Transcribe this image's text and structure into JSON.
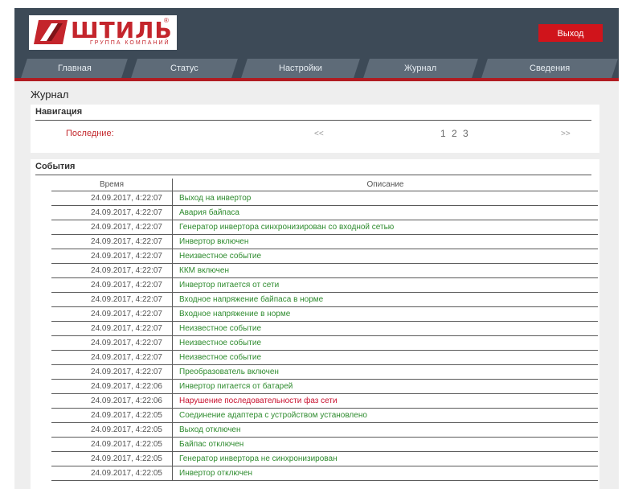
{
  "header": {
    "logo_text": "ШТИЛЬ",
    "logo_subtext": "ГРУППА КОМПАНИЙ",
    "logo_reg": "®",
    "logout_label": "Выход"
  },
  "colors": {
    "header_bg": "#3d4a57",
    "accent_red": "#d0141b",
    "success_green": "#2e8b2e",
    "error_red": "#c8102e"
  },
  "nav": {
    "tabs": [
      {
        "label": "Главная"
      },
      {
        "label": "Статус"
      },
      {
        "label": "Настройки"
      },
      {
        "label": "Журнал"
      },
      {
        "label": "Сведения"
      }
    ]
  },
  "page": {
    "title": "Журнал"
  },
  "navigation_panel": {
    "title": "Навигация",
    "last_label": "Последние:",
    "prev": "<<",
    "pages": "1 2 3",
    "next": ">>"
  },
  "events_panel": {
    "title": "События",
    "columns": [
      "Время",
      "Описание"
    ],
    "rows": [
      {
        "time": "24.09.2017, 4:22:07",
        "desc": "Выход на инвертор",
        "status": "ok"
      },
      {
        "time": "24.09.2017, 4:22:07",
        "desc": "Авария байпаса",
        "status": "ok"
      },
      {
        "time": "24.09.2017, 4:22:07",
        "desc": "Генератор инвертора синхронизирован со входной сетью",
        "status": "ok"
      },
      {
        "time": "24.09.2017, 4:22:07",
        "desc": "Инвертор включен",
        "status": "ok"
      },
      {
        "time": "24.09.2017, 4:22:07",
        "desc": "Неизвестное событие",
        "status": "ok"
      },
      {
        "time": "24.09.2017, 4:22:07",
        "desc": "ККМ включен",
        "status": "ok"
      },
      {
        "time": "24.09.2017, 4:22:07",
        "desc": "Инвертор питается от сети",
        "status": "ok"
      },
      {
        "time": "24.09.2017, 4:22:07",
        "desc": "Входное напряжение байпаса в норме",
        "status": "ok"
      },
      {
        "time": "24.09.2017, 4:22:07",
        "desc": "Входное напряжение в норме",
        "status": "ok"
      },
      {
        "time": "24.09.2017, 4:22:07",
        "desc": "Неизвестное событие",
        "status": "ok"
      },
      {
        "time": "24.09.2017, 4:22:07",
        "desc": "Неизвестное событие",
        "status": "ok"
      },
      {
        "time": "24.09.2017, 4:22:07",
        "desc": "Неизвестное событие",
        "status": "ok"
      },
      {
        "time": "24.09.2017, 4:22:07",
        "desc": "Преобразователь включен",
        "status": "ok"
      },
      {
        "time": "24.09.2017, 4:22:06",
        "desc": "Инвертор питается от батарей",
        "status": "ok"
      },
      {
        "time": "24.09.2017, 4:22:06",
        "desc": "Нарушение последовательности фаз сети",
        "status": "err"
      },
      {
        "time": "24.09.2017, 4:22:05",
        "desc": "Соединение адаптера с устройством установлено",
        "status": "ok"
      },
      {
        "time": "24.09.2017, 4:22:05",
        "desc": "Выход отключен",
        "status": "ok"
      },
      {
        "time": "24.09.2017, 4:22:05",
        "desc": "Байпас отключен",
        "status": "ok"
      },
      {
        "time": "24.09.2017, 4:22:05",
        "desc": "Генератор инвертора не синхронизирован",
        "status": "ok"
      },
      {
        "time": "24.09.2017, 4:22:05",
        "desc": "Инвертор отключен",
        "status": "ok"
      }
    ]
  }
}
